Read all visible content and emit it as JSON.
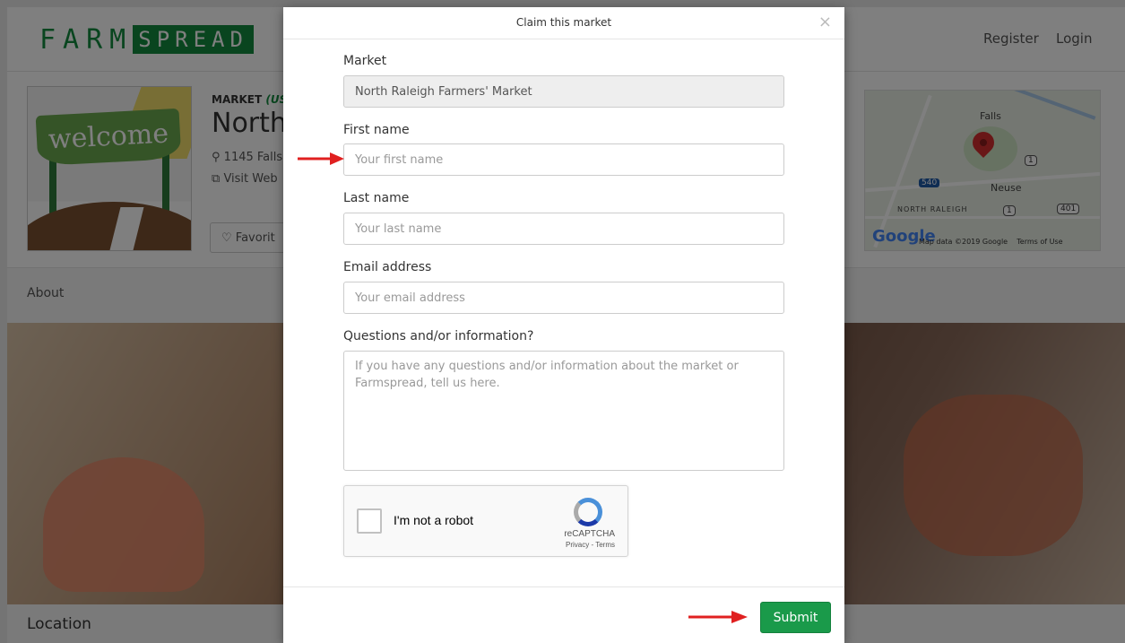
{
  "header": {
    "logo_farm": "FARM",
    "logo_spread": "SPREAD",
    "nav": {
      "register": "Register",
      "login": "Login"
    }
  },
  "market": {
    "label": "MARKET",
    "label_tag": "(US",
    "name": "North",
    "address": "1145 Falls",
    "website": "Visit Web",
    "favorite": "Favorit",
    "thumb_text": "welcome"
  },
  "map": {
    "labels": {
      "falls": "Falls",
      "neuse": "Neuse",
      "north_raleigh": "NORTH RALEIGH"
    },
    "shields": [
      "1",
      "1",
      "401",
      "540"
    ],
    "google": "Google",
    "data_text": "Map data ©2019 Google",
    "terms": "Terms of Use"
  },
  "tabs": {
    "about": "About"
  },
  "location": {
    "title": "Location"
  },
  "modal": {
    "title": "Claim this market",
    "close": "×",
    "fields": {
      "market": {
        "label": "Market",
        "value": "North Raleigh Farmers' Market"
      },
      "first_name": {
        "label": "First name",
        "placeholder": "Your first name"
      },
      "last_name": {
        "label": "Last name",
        "placeholder": "Your last name"
      },
      "email": {
        "label": "Email address",
        "placeholder": "Your email address"
      },
      "questions": {
        "label": "Questions and/or information?",
        "placeholder": "If you have any questions and/or information about the market or Farmspread, tell us here."
      }
    },
    "recaptcha": {
      "label": "I'm not a robot",
      "brand": "reCAPTCHA",
      "terms": "Privacy - Terms"
    },
    "submit": "Submit"
  },
  "colors": {
    "brand_green": "#138a3e",
    "submit_green": "#1a9a4a",
    "arrow_red": "#e02020"
  }
}
